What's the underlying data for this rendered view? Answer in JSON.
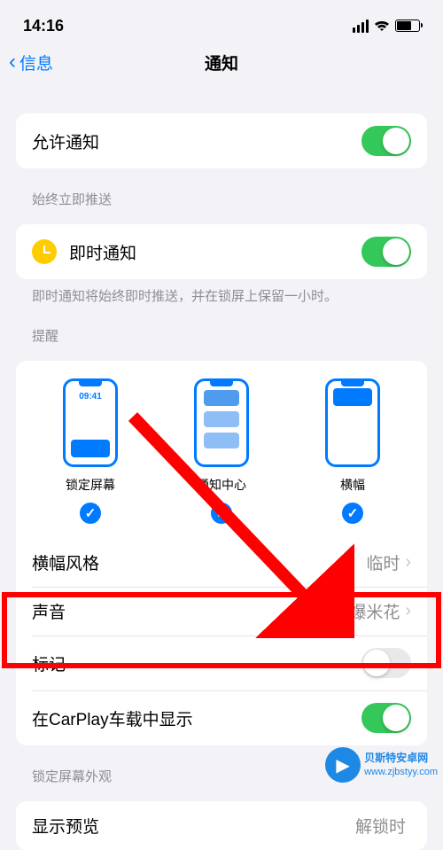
{
  "status_bar": {
    "time": "14:16"
  },
  "nav": {
    "back_label": "信息",
    "title": "通知"
  },
  "allow": {
    "label": "允许通知",
    "on": true
  },
  "immediate": {
    "header": "始终立即推送",
    "label": "即时通知",
    "on": true,
    "footer": "即时通知将始终即时推送，并在锁屏上保留一小时。"
  },
  "alerts": {
    "header": "提醒",
    "lock": {
      "label": "锁定屏幕",
      "time": "09:41",
      "checked": true
    },
    "center": {
      "label": "通知中心",
      "checked": true
    },
    "banner": {
      "label": "横幅",
      "checked": true
    }
  },
  "rows": {
    "banner_style": {
      "label": "横幅风格",
      "value": "临时"
    },
    "sound": {
      "label": "声音",
      "value": "爆米花"
    },
    "badge": {
      "label": "标记",
      "on": false
    },
    "carplay": {
      "label": "在CarPlay车载中显示",
      "on": true
    }
  },
  "lockscreen_section": {
    "header": "锁定屏幕外观",
    "preview_label": "显示预览",
    "preview_value": "解锁时"
  },
  "watermark": {
    "name": "贝斯特安卓网",
    "url": "www.zjbstyy.com"
  }
}
